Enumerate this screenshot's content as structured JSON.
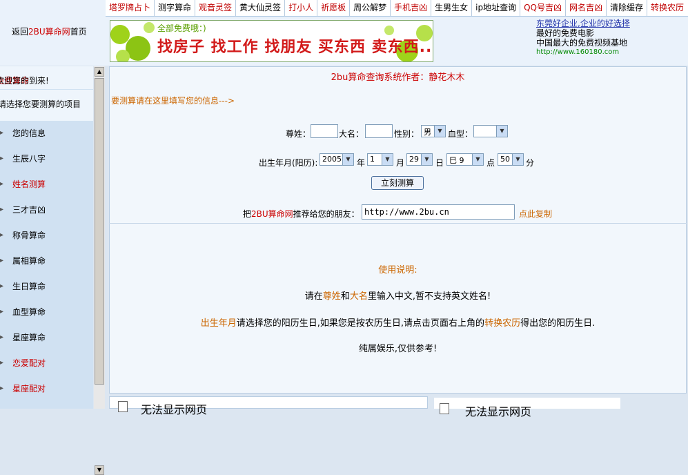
{
  "nav": [
    {
      "label": "塔罗牌占卜",
      "color": "red"
    },
    {
      "label": "测字算命",
      "color": "black"
    },
    {
      "label": "观音灵签",
      "color": "red"
    },
    {
      "label": "黄大仙灵签",
      "color": "black"
    },
    {
      "label": "打小人",
      "color": "red"
    },
    {
      "label": "祈愿板",
      "color": "red"
    },
    {
      "label": "周公解梦",
      "color": "black"
    },
    {
      "label": "手机吉凶",
      "color": "red"
    },
    {
      "label": "生男生女",
      "color": "black"
    },
    {
      "label": "ip地址查询",
      "color": "black"
    },
    {
      "label": "QQ号吉凶",
      "color": "red"
    },
    {
      "label": "网名吉凶",
      "color": "red"
    },
    {
      "label": "清除缓存",
      "color": "black"
    },
    {
      "label": "转换农历",
      "color": "red"
    }
  ],
  "home": {
    "prefix": "返回",
    "site": "2BU算命网",
    "suffix": "首页"
  },
  "banner": {
    "top": "全部免费哦：)",
    "main": "找房子 找工作 找朋友 买东西 卖东西..."
  },
  "ad": {
    "line1": "东莞好企业,企业的好选择",
    "line2": "最好的免费电影",
    "line3": "中国最大的免费视频基地",
    "line4": "http://www.160180.com"
  },
  "sidebar": {
    "welcome_red": "免费算命",
    "welcome_rest": "欢迎您的到来!",
    "select_tip": "请选择您要测算的项目",
    "items": [
      {
        "label": "您的信息",
        "red": false
      },
      {
        "label": "生辰八字",
        "red": false
      },
      {
        "label": "姓名测算",
        "red": true
      },
      {
        "label": "三才吉凶",
        "red": false
      },
      {
        "label": "称骨算命",
        "red": false
      },
      {
        "label": "属相算命",
        "red": false
      },
      {
        "label": "生日算命",
        "red": false
      },
      {
        "label": "血型算命",
        "red": false
      },
      {
        "label": "星座算命",
        "red": false
      },
      {
        "label": "恋爱配对",
        "red": true
      },
      {
        "label": "星座配对",
        "red": true
      }
    ]
  },
  "main": {
    "author": "2bu算命查询系统作者：静花木木",
    "fill_tip": "要测算请在这里填写您的信息--->",
    "surname_label": "尊姓：",
    "name_label": "大名：",
    "gender_label": "性别：",
    "gender_value": "男",
    "blood_label": "血型：",
    "blood_value": "",
    "birth_label": "出生年月(阳历):",
    "year": "2005",
    "year_unit": "年",
    "month": "1",
    "month_unit": "月",
    "day": "29",
    "day_unit": "日",
    "hour_branch": "巳 9",
    "hour_unit": "点",
    "minute": "50",
    "minute_unit": "分",
    "calc_button": "立刻测算",
    "rec_prefix": "把",
    "rec_site": "2BU算命网",
    "rec_suffix": "推荐给您的朋友：",
    "rec_url": "http://www.2bu.cn",
    "copy_link": "点此复制",
    "usage_title": "使用说明:",
    "usage1_a": "请在",
    "usage1_b": "尊姓",
    "usage1_c": "和",
    "usage1_d": "大名",
    "usage1_e": "里输入中文,暂不支持英文姓名!",
    "usage2_a": "出生年月",
    "usage2_b": "请选择您的阳历生日,如果您是按农历生日,请点击页面右上角的",
    "usage2_c": "转换农历",
    "usage2_d": "得出您的阳历生日.",
    "usage3": "纯属娱乐,仅供参考!"
  },
  "bottom": {
    "left_error": "无法显示网页",
    "right_error": "无法显示网页"
  }
}
